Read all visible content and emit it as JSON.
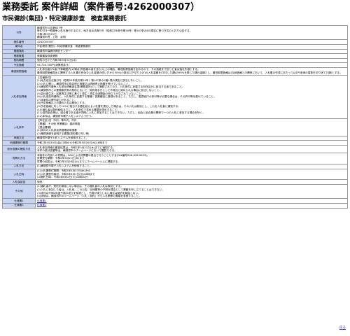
{
  "page": {
    "title": "業務委託 案件詳細（案件番号:4262000307）",
    "subtitle": "市民健診(集団)・特定健康診査　検査業務委託",
    "back_label": "戻る"
  },
  "rows": [
    {
      "key": "公告",
      "lines": [
        "横須賀市公告第627号",
        "条件付き一般競争入札を施行するので，地方自治法施行令（昭和22年政令第16号）第167条の6の規定に基づき次のとおり公告する。",
        "令和2年5月15日",
        "横須賀市長　上地　克明"
      ]
    },
    {
      "key": "案件番号",
      "lines": [
        "4262000307"
      ]
    },
    {
      "key": "案件名",
      "lines": [
        "市民健診(集団)・特定健康診査　検査業務委託"
      ]
    },
    {
      "key": "業務場所",
      "lines": [
        "横須賀市保健所健診センター"
      ]
    },
    {
      "key": "業務概要",
      "lines": [
        "健康審査検査業務"
      ]
    },
    {
      "key": "契約期間",
      "lines": [
        "契約の日から令和3年3月31日(水)"
      ]
    },
    {
      "key": "予定価格",
      "lines": [
        "¥4,726,760円(消費税抜き)"
      ]
    },
    {
      "key": "最低制限価格",
      "lines": [
        "入札参加者が5者(予算範囲内)の場合(同価格の者を含む)以上の場合，最低制限価格を定めるので，その価格を下回った者は落札失格とする。",
        "最低制限価格算出に関係する入札書の有効な入札金額の低い方から50%(小数点以下切り上げ)の入札金額を(平均した額)の90%を乗じた額の金額とし，最低制限価格は(当該価格との関係において，入札書の作成にあたっては1円未満の端数を切り捨てた額)とする。"
      ]
    },
    {
      "key": "入札参加資格",
      "lines": [
        "【共通条件】",
        "(1)地方自治法施行令（昭和22年政令第16号）第167条の4第1項の規定に該当しないこと。",
        "(2)入札に関し，横須賀市の指名停止措置又は資格停止措置を受けていないこと。",
        "(3)横須賀市競争入札参加資格者名簿(業務委託)として登録されており，入札条件に記載する所在区分に該当する者であること。",
        "(4)横須賀市との業務委託等の契約において，契約相手方として不適当と認められる事由に該当しないこと。",
        "(5)会社更生法・民事再生法等に基づく更生・再生手続開始の申立てがなされていないこと。",
        "(6)入札参加申請時に，入札条件に記載する業種・営業種目に登録があること。ただし，監督官庁の許可等が必要な場合は，その許可等を受けていること。",
        "(7)本案件の履行能力があること。",
        "(8)予定価格以上の額の入札は無効とする。",
        "(9)予定価格に対して10%に相当する額を超える入札書を提出した場合は，その入札は無効とし，これを入札者に通知する。",
        "(10)落札者は契約締結までに，入札条件で求める書類を提出すること。",
        "(11)協同組合等は，組合員である者が同時に入札に参加することはできない。ただし，組合と組合員の関係で一つの入札に参加する場合を除く。",
        "(12)本件は，横須賀市電子入札システムで行う。"
      ]
    },
    {
      "key": "入札条件",
      "lines": [
        "【所在区分】 市内，準市内，市外",
        "【業種】 その他 営業種目：臨床検査",
        "【提出書類】",
        "(1)本件の入札参加資格確認申請書",
        "(2)業務実績を証明する書類(契約書の写し等)"
      ]
    },
    {
      "key": "申請方法",
      "lines": [
        "横須賀市電子入札システムを使用すること。"
      ]
    },
    {
      "key": "申請書受付期間",
      "lines": [
        "令和2年5月15日(金)15時から令和2年5月20日(水)16時まで"
      ]
    },
    {
      "key": "設計図書の閲覧方法",
      "lines": [
        "入札参加資格の審査結果は，令和2年5月21日(木)までに通知する。",
        "本件の設計図書等は，横須賀市のホームページにおいて閲覧できる。"
      ]
    },
    {
      "key": "質問の方法",
      "lines": [
        "本案件の内容への質問は，FAXによる質問書の提出で行うこととする(FAX番号046-828-0839)。",
        "質問受付期間：令和2年5月21日(木)まで",
        "質問の回答は，令和2年5月26日(火)までにホームページ上に掲載する。"
      ]
    },
    {
      "key": "入札方法",
      "lines": [
        "(1)横須賀市電子入札システムを使用すること。"
      ]
    },
    {
      "key": "入札日時",
      "lines": [
        "(1)入札書受付期間：令和2年5月27日(水)から",
        "(2)入札書受付締切：令和2年6月1日(月)16時まで",
        "(3)開札日時：令和2年6月2日(火)10時00分"
      ]
    },
    {
      "key": "入札保証金",
      "lines": [
        "免除"
      ]
    },
    {
      "key": "その他",
      "lines": [
        "(1)落札者が，契約を締結しない場合は，その落札者の入札は無効とする。",
        "(2)入札に参加した者は，入札後，この公告，仕様書等の不明を理由として異議を申し立てることはできない。",
        "(3)本件は令和2年度予算の成立を前提とし，予算が成立しない場合は契約を締結しない。",
        "(4)詳細は，横須賀市のホームページ『入札・契約』から入札関係の書類を参照すること。"
      ]
    },
    {
      "key": "仕様書1",
      "lines": [
        "仕様書1"
      ],
      "link": true
    },
    {
      "key": "仕様書2",
      "lines": [
        "仕様書2"
      ],
      "link": true
    }
  ]
}
